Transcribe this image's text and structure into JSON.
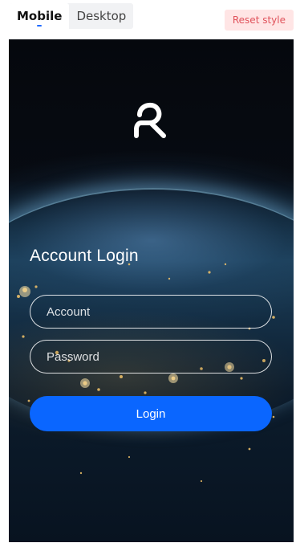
{
  "topbar": {
    "tabs": [
      {
        "label": "Mobile",
        "active": true
      },
      {
        "label": "Desktop",
        "active": false
      }
    ],
    "reset_label": "Reset style"
  },
  "login": {
    "title": "Account Login",
    "account_placeholder": "Account",
    "password_placeholder": "Password",
    "login_label": "Login"
  },
  "colors": {
    "accent": "#0a66ff",
    "reset_bg": "#ffe5e5",
    "reset_text": "#e0525b",
    "tab_indicator": "#1f6bff"
  },
  "icons": {
    "logo": "brand-logo-icon"
  }
}
